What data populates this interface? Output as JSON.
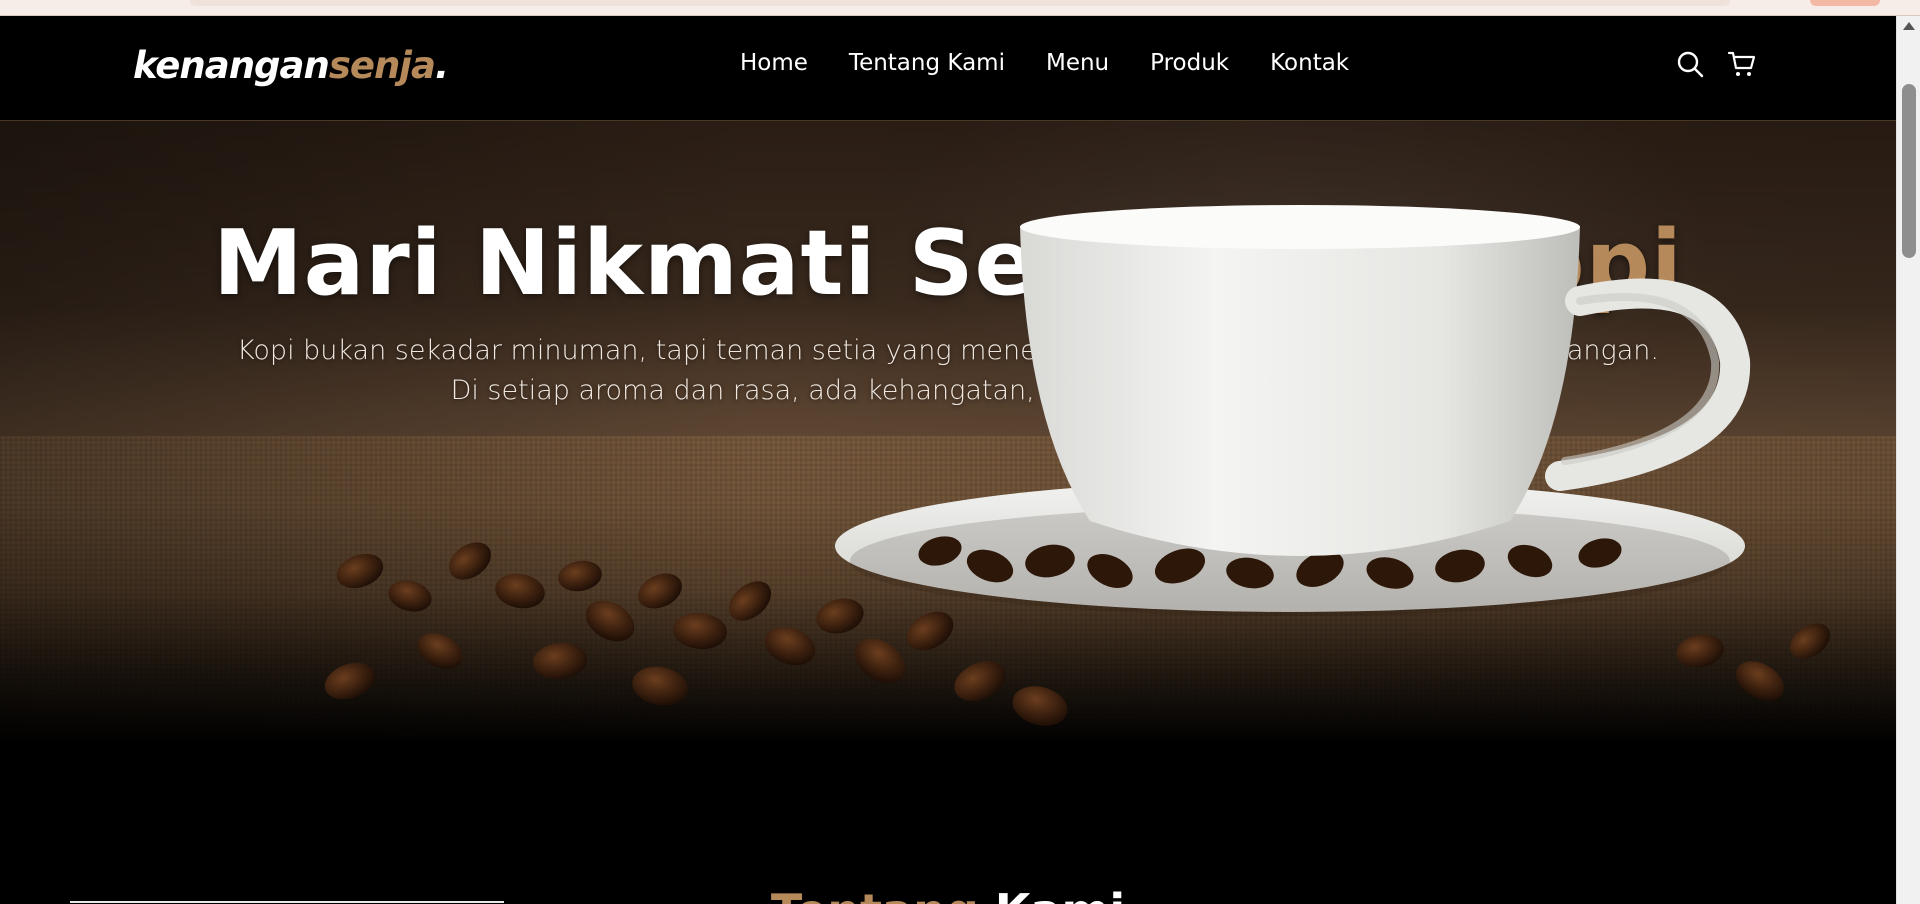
{
  "brand": {
    "name_main": "kenangan",
    "name_accent": "senja",
    "name_dot": "."
  },
  "nav": {
    "items": [
      {
        "label": "Home"
      },
      {
        "label": "Tentang Kami"
      },
      {
        "label": "Menu"
      },
      {
        "label": "Produk"
      },
      {
        "label": "Kontak"
      }
    ],
    "icons": [
      "search-icon",
      "cart-icon"
    ]
  },
  "hero": {
    "title_main": "Mari Nikmati Secangkir ",
    "title_accent": "Kopi",
    "subtitle_line1": "Kopi bukan sekadar minuman, tapi teman setia yang menemani setiap cerita, perjalanan, dan kenangan.",
    "subtitle_line2": "Di setiap aroma dan rasa, ada kehangatan, inspirasi, dan semangat baru."
  },
  "next_section": {
    "title_main": "Tentang ",
    "title_accent": "Kami"
  },
  "colors": {
    "accent": "#b6895b",
    "background": "#000000",
    "text": "#ffffff"
  }
}
